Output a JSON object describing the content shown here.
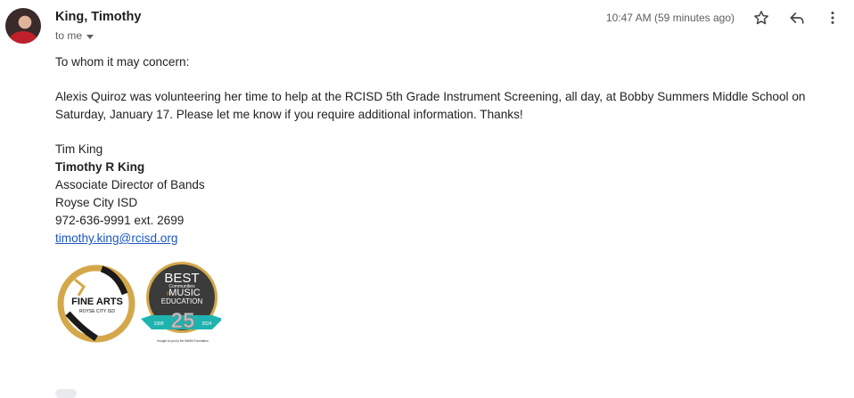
{
  "header": {
    "sender_name": "King, Timothy",
    "recipient": "to me",
    "timestamp": "10:47 AM (59 minutes ago)"
  },
  "icons": {
    "star": "star-icon",
    "reply": "reply-icon",
    "more": "more-vert-icon",
    "recipient_caret": "chevron-down-icon"
  },
  "body": {
    "greeting": "To whom it may concern:",
    "paragraph": "Alexis Quiroz was volunteering her time to help at the RCISD 5th Grade Instrument Screening, all day, at Bobby Summers Middle School on Saturday, January 17.  Please let me know if you require additional information.  Thanks!",
    "signoff": "Tim King"
  },
  "signature": {
    "name": "Timothy R King",
    "title": "Associate Director of Bands",
    "org": "Royse City ISD",
    "phone": "972-636-9991 ext. 2699",
    "email": "timothy.king@rcisd.org"
  },
  "logos": {
    "fine_arts_line1": "FINE ARTS",
    "fine_arts_line2": "ROYSE CITY ISD",
    "best_line1": "BEST",
    "best_line2": "Communities",
    "best_line3": "for",
    "best_line4": "MUSIC",
    "best_line5": "EDUCATION",
    "best_number": "25",
    "best_year_start": "1999",
    "best_year_end": "2024",
    "best_footer": "brought to you by the NAMM Foundation"
  },
  "colors": {
    "link": "#1a56c4",
    "gold": "#d4a84a",
    "teal": "#1fb3b0",
    "dark_circle": "#3b3b3b"
  }
}
